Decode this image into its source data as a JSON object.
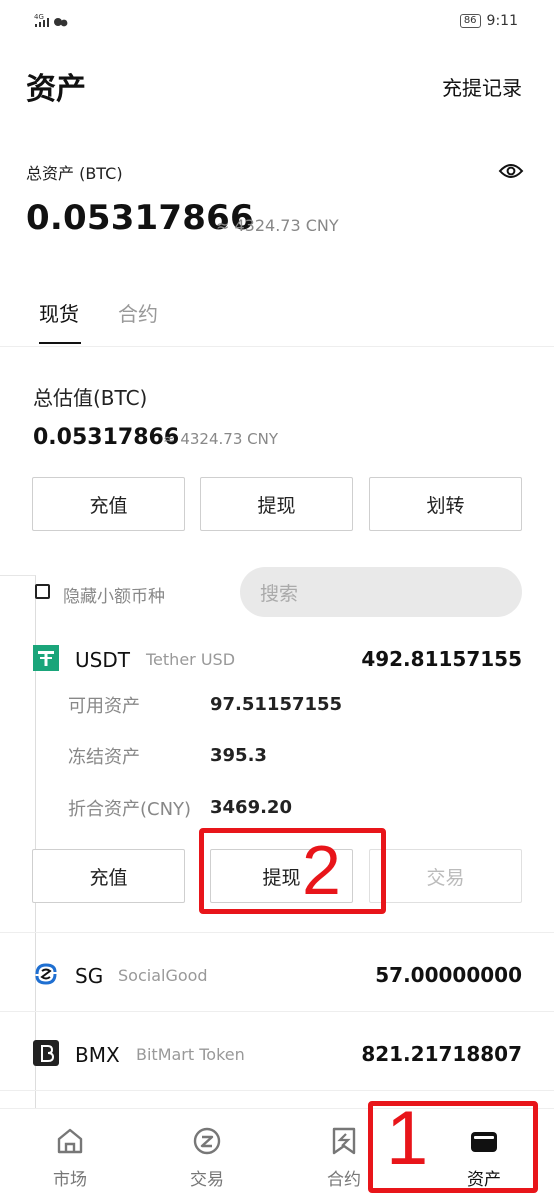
{
  "status_bar": {
    "network": "4G",
    "battery": "86",
    "time": "9:11"
  },
  "header": {
    "title": "资产",
    "records_link": "充提记录"
  },
  "total": {
    "label": "总资产 (BTC)",
    "value": "0.05317866",
    "cny": "≈ 4324.73 CNY"
  },
  "tabs": [
    {
      "label": "现货",
      "active": true
    },
    {
      "label": "合约",
      "active": false
    }
  ],
  "estimate": {
    "label": "总估值(BTC)",
    "value": "0.05317866",
    "cny": "≈ 4324.73 CNY",
    "buttons": {
      "deposit": "充值",
      "withdraw": "提现",
      "transfer": "划转"
    }
  },
  "filter": {
    "hide_small_label": "隐藏小额币种",
    "search_placeholder": "搜索"
  },
  "coins": [
    {
      "symbol": "USDT",
      "name": "Tether USD",
      "balance": "492.81157155",
      "details": [
        {
          "label": "可用资产",
          "value": "97.51157155"
        },
        {
          "label": "冻结资产",
          "value": "395.3"
        },
        {
          "label": "折合资产(CNY)",
          "value": "3469.20"
        }
      ],
      "actions": {
        "deposit": "充值",
        "withdraw": "提现",
        "trade": "交易"
      }
    },
    {
      "symbol": "SG",
      "name": "SocialGood",
      "balance": "57.00000000"
    },
    {
      "symbol": "BMX",
      "name": "BitMart Token",
      "balance": "821.21718807"
    }
  ],
  "annotations": {
    "one": "1",
    "two": "2",
    "color": "#e8151a"
  },
  "bottom_nav": [
    {
      "label": "市场",
      "icon": "home-icon"
    },
    {
      "label": "交易",
      "icon": "trade-icon"
    },
    {
      "label": "合约",
      "icon": "contract-icon"
    },
    {
      "label": "资产",
      "icon": "wallet-icon",
      "active": true
    }
  ]
}
